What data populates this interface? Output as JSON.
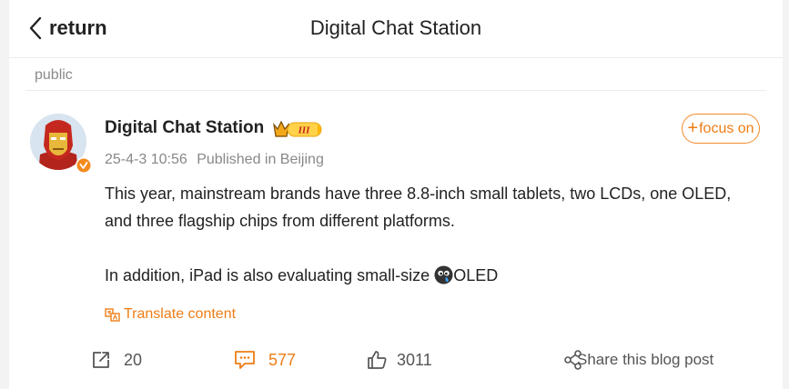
{
  "header": {
    "back_label": "return",
    "title": "Digital Chat Station"
  },
  "section": {
    "label": "public"
  },
  "post": {
    "author": "Digital Chat Station",
    "date": "25-4-3 10:56",
    "location": "Published in Beijing",
    "follow_label": "focus on",
    "paragraph1": "This year, mainstream brands have three 8.8-inch small tablets, two LCDs, one OLED, and three flagship chips from different platforms.",
    "paragraph2_before_emoji": "In addition, iPad is also evaluating small-size ",
    "paragraph2_after_emoji": "OLED",
    "translate_label": "Translate content"
  },
  "actions": {
    "repost_count": "20",
    "comment_count": "577",
    "like_count": "3011",
    "share_label": "Share this blog post"
  },
  "colors": {
    "accent": "#ee7d16",
    "text": "#222222",
    "muted": "#888888",
    "divider": "#ededed"
  },
  "icons": [
    "chevron-left-icon",
    "crown-vip-badge",
    "verified-badge-icon",
    "emoji-icon",
    "translate-icon",
    "repost-icon",
    "comment-icon",
    "like-icon",
    "share-icon"
  ]
}
